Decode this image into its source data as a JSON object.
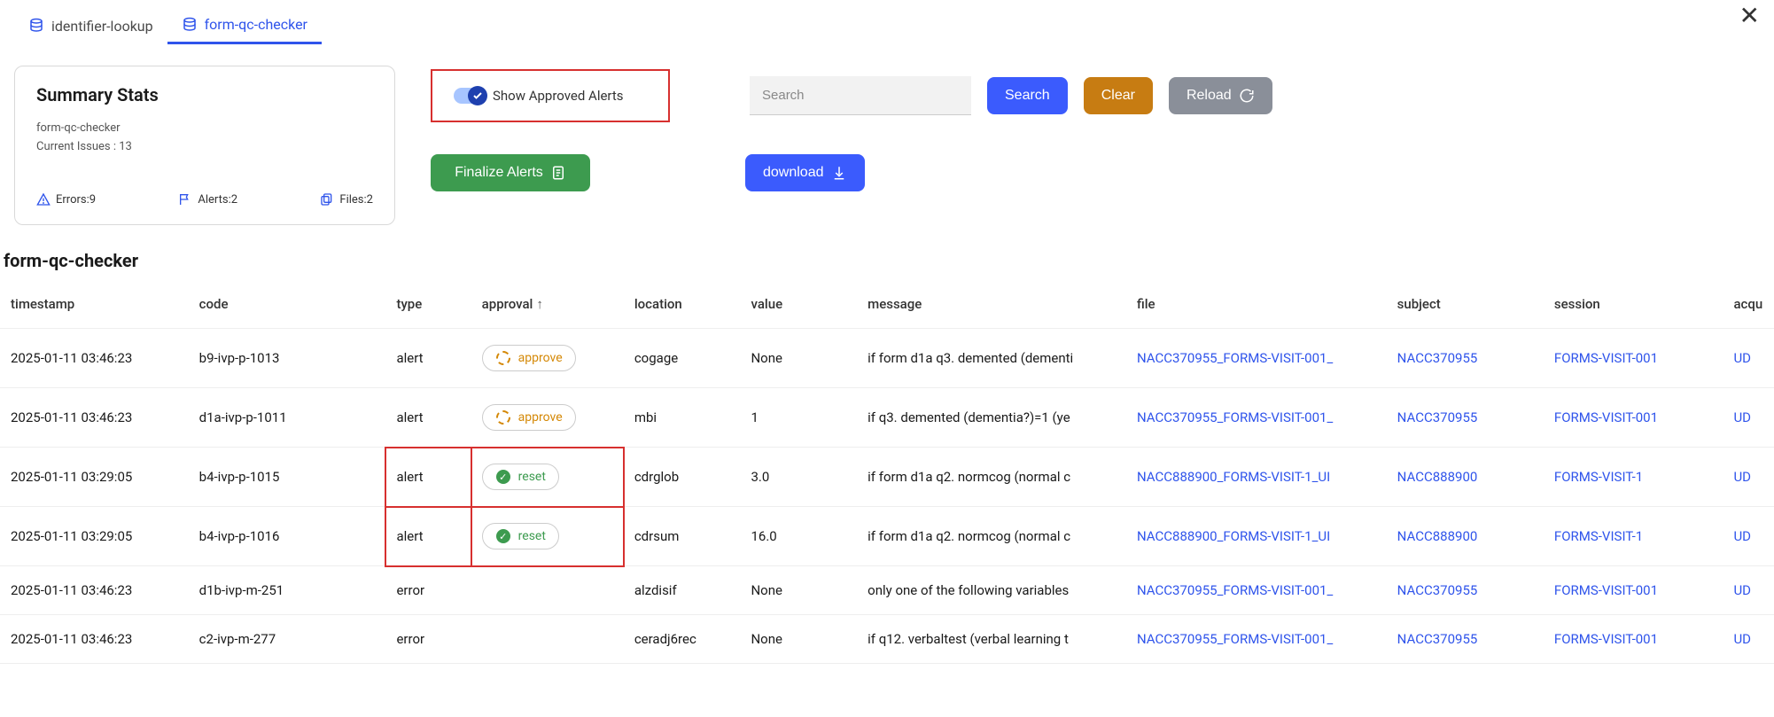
{
  "tabs": [
    {
      "label": "identifier-lookup",
      "active": false
    },
    {
      "label": "form-qc-checker",
      "active": true
    }
  ],
  "stats": {
    "title": "Summary Stats",
    "subtitle": "form-qc-checker",
    "current_issues_label": "Current Issues : 13",
    "errors_label": "Errors:9",
    "alerts_label": "Alerts:2",
    "files_label": "Files:2"
  },
  "controls": {
    "toggle_label": "Show Approved Alerts",
    "search_placeholder": "Search",
    "search_btn": "Search",
    "clear_btn": "Clear",
    "reload_btn": "Reload",
    "finalize_btn": "Finalize Alerts",
    "download_btn": "download"
  },
  "section_title": "form-qc-checker",
  "columns": {
    "timestamp": "timestamp",
    "code": "code",
    "type": "type",
    "approval": "approval",
    "location": "location",
    "value": "value",
    "message": "message",
    "file": "file",
    "subject": "subject",
    "session": "session",
    "acq": "acqu"
  },
  "approval_labels": {
    "approve": "approve",
    "reset": "reset"
  },
  "rows": [
    {
      "timestamp": "2025-01-11 03:46:23",
      "code": "b9-ivp-p-1013",
      "type": "alert",
      "approval": "approve",
      "location": "cogage",
      "value": "None",
      "message": "if form d1a q3. demented (dementi",
      "file": "NACC370955_FORMS-VISIT-001_",
      "subject": "NACC370955",
      "session": "FORMS-VISIT-001",
      "acq": "UD",
      "highlight": false
    },
    {
      "timestamp": "2025-01-11 03:46:23",
      "code": "d1a-ivp-p-1011",
      "type": "alert",
      "approval": "approve",
      "location": "mbi",
      "value": "1",
      "message": "if q3. demented (dementia?)=1 (ye",
      "file": "NACC370955_FORMS-VISIT-001_",
      "subject": "NACC370955",
      "session": "FORMS-VISIT-001",
      "acq": "UD",
      "highlight": false
    },
    {
      "timestamp": "2025-01-11 03:29:05",
      "code": "b4-ivp-p-1015",
      "type": "alert",
      "approval": "reset",
      "location": "cdrglob",
      "value": "3.0",
      "message": "if form d1a q2. normcog (normal c",
      "file": "NACC888900_FORMS-VISIT-1_UI",
      "subject": "NACC888900",
      "session": "FORMS-VISIT-1",
      "acq": "UD",
      "highlight": true
    },
    {
      "timestamp": "2025-01-11 03:29:05",
      "code": "b4-ivp-p-1016",
      "type": "alert",
      "approval": "reset",
      "location": "cdrsum",
      "value": "16.0",
      "message": "if form d1a q2. normcog (normal c",
      "file": "NACC888900_FORMS-VISIT-1_UI",
      "subject": "NACC888900",
      "session": "FORMS-VISIT-1",
      "acq": "UD",
      "highlight": true
    },
    {
      "timestamp": "2025-01-11 03:46:23",
      "code": "d1b-ivp-m-251",
      "type": "error",
      "approval": "",
      "location": "alzdisif",
      "value": "None",
      "message": "only one of the following variables",
      "file": "NACC370955_FORMS-VISIT-001_",
      "subject": "NACC370955",
      "session": "FORMS-VISIT-001",
      "acq": "UD",
      "highlight": false
    },
    {
      "timestamp": "2025-01-11 03:46:23",
      "code": "c2-ivp-m-277",
      "type": "error",
      "approval": "",
      "location": "ceradj6rec",
      "value": "None",
      "message": "if q12. verbaltest (verbal learning t",
      "file": "NACC370955_FORMS-VISIT-001_",
      "subject": "NACC370955",
      "session": "FORMS-VISIT-001",
      "acq": "UD",
      "highlight": false
    }
  ]
}
